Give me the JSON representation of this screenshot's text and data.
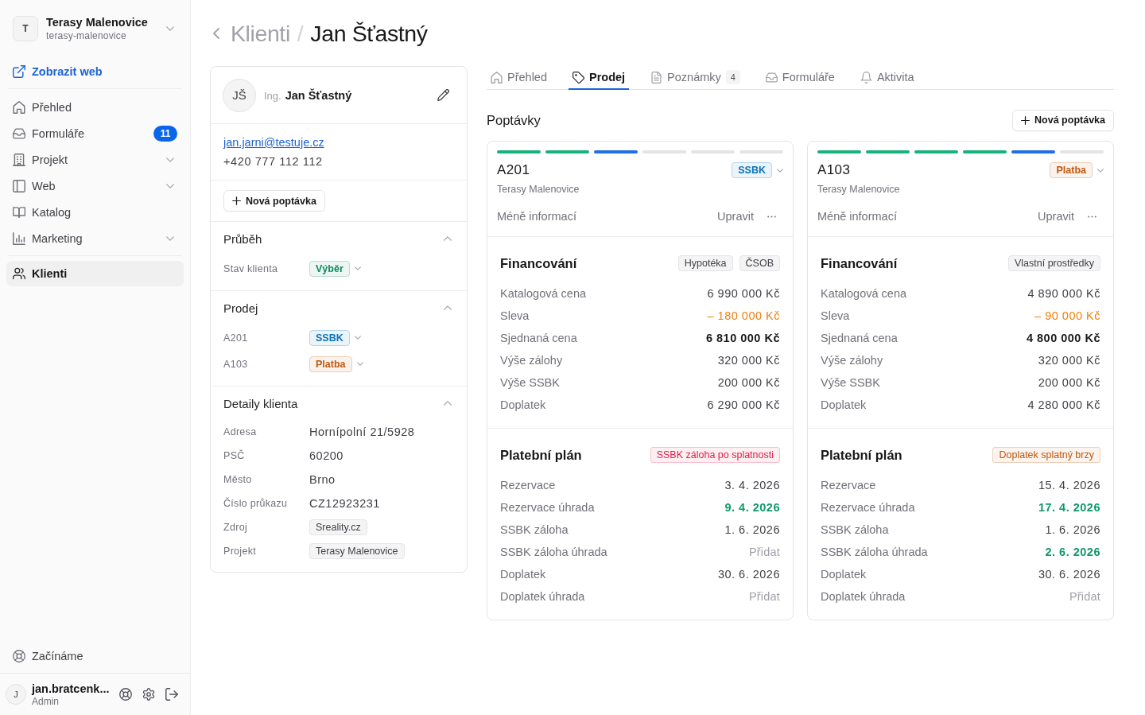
{
  "sidebar": {
    "workspace": {
      "initial": "T",
      "name": "Terasy Malenovice",
      "slug": "terasy-malenovice"
    },
    "view_site_link": "Zobrazit web",
    "nav_groups": [
      {
        "items": [
          {
            "label": "Přehled",
            "expandable": false,
            "selected": false
          },
          {
            "label": "Formuláře",
            "badge": "11",
            "expandable": false,
            "selected": false
          },
          {
            "label": "Projekt",
            "expandable": true,
            "selected": false
          },
          {
            "label": "Web",
            "expandable": true,
            "selected": false
          },
          {
            "label": "Katalog",
            "expandable": false,
            "selected": false
          },
          {
            "label": "Marketing",
            "expandable": true,
            "selected": false
          }
        ]
      },
      {
        "items": [
          {
            "label": "Klienti",
            "expandable": false,
            "selected": true
          }
        ]
      }
    ],
    "help_link": "Začínáme",
    "user": {
      "initial": "J",
      "name": "jan.bratcenk...",
      "role": "Admin"
    }
  },
  "breadcrumb": {
    "parent": "Klienti",
    "separator": "/",
    "current": "Jan Šťastný"
  },
  "client": {
    "avatar": "JŠ",
    "title": "Ing.",
    "name": "Jan Šťastný",
    "email": "jan.jarni@testuje.cz",
    "phone": "+420 777 112 112",
    "new_inquiry_button": "Nová poptávka",
    "sections": [
      {
        "title": "Průběh",
        "expanded": true,
        "rows": [
          {
            "label": "Stav klienta",
            "kind": "status",
            "value": "Výběr",
            "color": "#0f8a5f"
          }
        ]
      },
      {
        "title": "Prodej",
        "expanded": true,
        "rows": [
          {
            "label": "A201",
            "kind": "status",
            "value": "SSBK",
            "color": "#0b74b8"
          },
          {
            "label": "A103",
            "kind": "status",
            "value": "Platba",
            "color": "#c2570c"
          }
        ]
      },
      {
        "title": "Detaily klienta",
        "expanded": true,
        "rows": [
          {
            "label": "Adresa",
            "kind": "text",
            "value": "Hornípolní 21/5928"
          },
          {
            "label": "PSČ",
            "kind": "text",
            "value": "60200"
          },
          {
            "label": "Město",
            "kind": "text",
            "value": "Brno"
          },
          {
            "label": "Číslo průkazu",
            "kind": "text",
            "value": "CZ12923231"
          },
          {
            "label": "Zdroj",
            "kind": "tag",
            "value": "Sreality.cz"
          },
          {
            "label": "Projekt",
            "kind": "tag",
            "value": "Terasy Malenovice"
          }
        ]
      }
    ]
  },
  "tabs": [
    {
      "label": "Přehled",
      "selected": false
    },
    {
      "label": "Prodej",
      "selected": true
    },
    {
      "label": "Poznámky",
      "count": "4",
      "selected": false
    },
    {
      "label": "Formuláře",
      "selected": false
    },
    {
      "label": "Aktivita",
      "selected": false
    }
  ],
  "inquiries": {
    "title": "Poptávky",
    "new_button": "Nová poptávka",
    "cards": [
      {
        "progress": [
          {
            "color": "#19b27b"
          },
          {
            "color": "#19b27b"
          },
          {
            "color": "#1f6fe5"
          },
          {
            "color": "#e4e4e7"
          },
          {
            "color": "#e4e4e7"
          },
          {
            "color": "#e4e4e7"
          }
        ],
        "unit": "A201",
        "status": {
          "label": "SSBK",
          "color": "#0b74b8"
        },
        "project": "Terasy Malenovice",
        "toggle": "Méně informací",
        "edit": "Upravit",
        "financing": {
          "title": "Financování",
          "tags": [
            "Hypotéka",
            "ČSOB"
          ],
          "rows": [
            {
              "label": "Katalogová cena",
              "value": "6 990 000 Kč",
              "kind": "plain"
            },
            {
              "label": "Sleva",
              "value": "– 180 000 Kč",
              "kind": "discount"
            },
            {
              "label": "Sjednaná cena",
              "value": "6 810 000 Kč",
              "kind": "total"
            },
            {
              "label": "Výše zálohy",
              "value": "320 000 Kč",
              "kind": "plain"
            },
            {
              "label": "Výše SSBK",
              "value": "200 000 Kč",
              "kind": "plain"
            },
            {
              "label": "Doplatek",
              "value": "6 290 000 Kč",
              "kind": "plain"
            }
          ]
        },
        "payment_plan": {
          "title": "Platební plán",
          "alert": {
            "label": "SSBK záloha po splatnosti",
            "color": "#e11d48"
          },
          "rows": [
            {
              "label": "Rezervace",
              "value": "3. 4. 2026",
              "kind": "plain"
            },
            {
              "label": "Rezervace úhrada",
              "value": "9. 4. 2026",
              "kind": "paid"
            },
            {
              "label": "SSBK záloha",
              "value": "1. 6. 2026",
              "kind": "plain"
            },
            {
              "label": "SSBK záloha úhrada",
              "value": "Přidat",
              "kind": "empty"
            },
            {
              "label": "Doplatek",
              "value": "30. 6. 2026",
              "kind": "plain"
            },
            {
              "label": "Doplatek úhrada",
              "value": "Přidat",
              "kind": "empty"
            }
          ]
        }
      },
      {
        "progress": [
          {
            "color": "#19b27b"
          },
          {
            "color": "#19b27b"
          },
          {
            "color": "#19b27b"
          },
          {
            "color": "#19b27b"
          },
          {
            "color": "#1f6fe5"
          },
          {
            "color": "#e4e4e7"
          }
        ],
        "unit": "A103",
        "status": {
          "label": "Platba",
          "color": "#c2570c"
        },
        "project": "Terasy Malenovice",
        "toggle": "Méně informací",
        "edit": "Upravit",
        "financing": {
          "title": "Financování",
          "tags": [
            "Vlastní prostředky"
          ],
          "rows": [
            {
              "label": "Katalogová cena",
              "value": "4 890 000 Kč",
              "kind": "plain"
            },
            {
              "label": "Sleva",
              "value": "– 90 000 Kč",
              "kind": "discount"
            },
            {
              "label": "Sjednaná cena",
              "value": "4 800 000 Kč",
              "kind": "total"
            },
            {
              "label": "Výše zálohy",
              "value": "320 000 Kč",
              "kind": "plain"
            },
            {
              "label": "Výše SSBK",
              "value": "200 000 Kč",
              "kind": "plain"
            },
            {
              "label": "Doplatek",
              "value": "4 280 000 Kč",
              "kind": "plain"
            }
          ]
        },
        "payment_plan": {
          "title": "Platební plán",
          "alert": {
            "label": "Doplatek splatný brzy",
            "color": "#c2570c"
          },
          "rows": [
            {
              "label": "Rezervace",
              "value": "15. 4. 2026",
              "kind": "plain"
            },
            {
              "label": "Rezervace úhrada",
              "value": "17. 4. 2026",
              "kind": "paid"
            },
            {
              "label": "SSBK záloha",
              "value": "1. 6. 2026",
              "kind": "plain"
            },
            {
              "label": "SSBK záloha úhrada",
              "value": "2. 6. 2026",
              "kind": "paid"
            },
            {
              "label": "Doplatek",
              "value": "30. 6. 2026",
              "kind": "plain"
            },
            {
              "label": "Doplatek úhrada",
              "value": "Přidat",
              "kind": "empty"
            }
          ]
        }
      }
    ]
  }
}
